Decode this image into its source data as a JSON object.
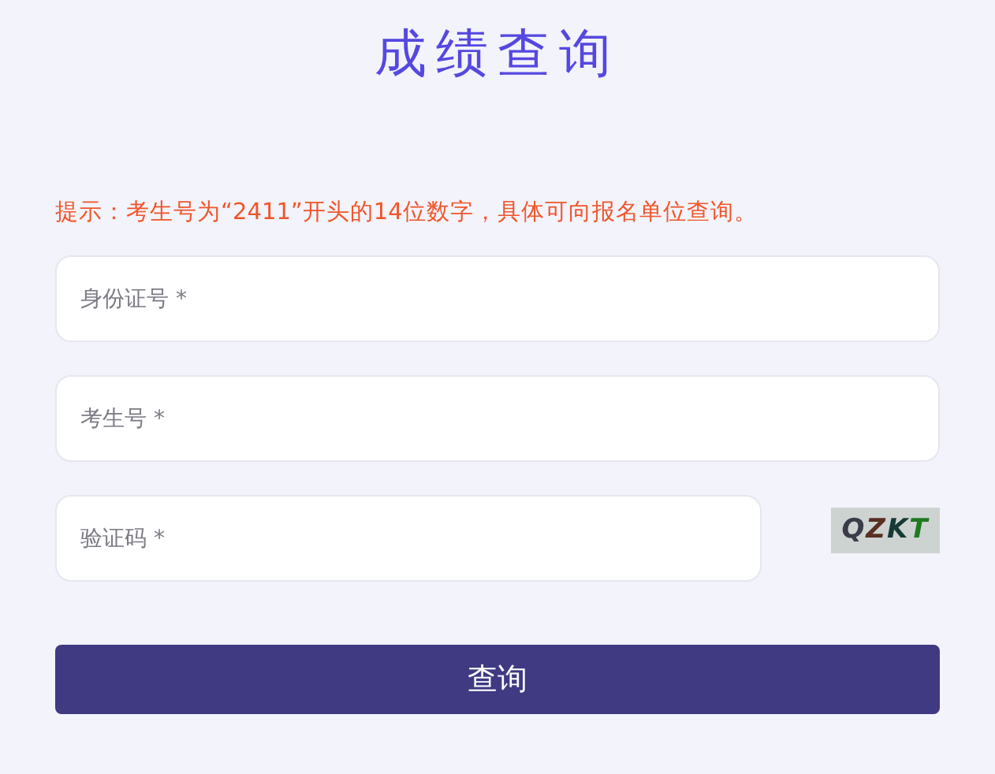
{
  "title": "成绩查询",
  "hint": "提示：考生号为“2411”开头的14位数字，具体可向报名单位查询。",
  "fields": [
    {
      "placeholder": "身份证号 *"
    },
    {
      "placeholder": "考生号 *"
    },
    {
      "placeholder": "验证码 *",
      "kind": "captcha"
    }
  ],
  "captcha": "QZKT",
  "submit": "查询"
}
